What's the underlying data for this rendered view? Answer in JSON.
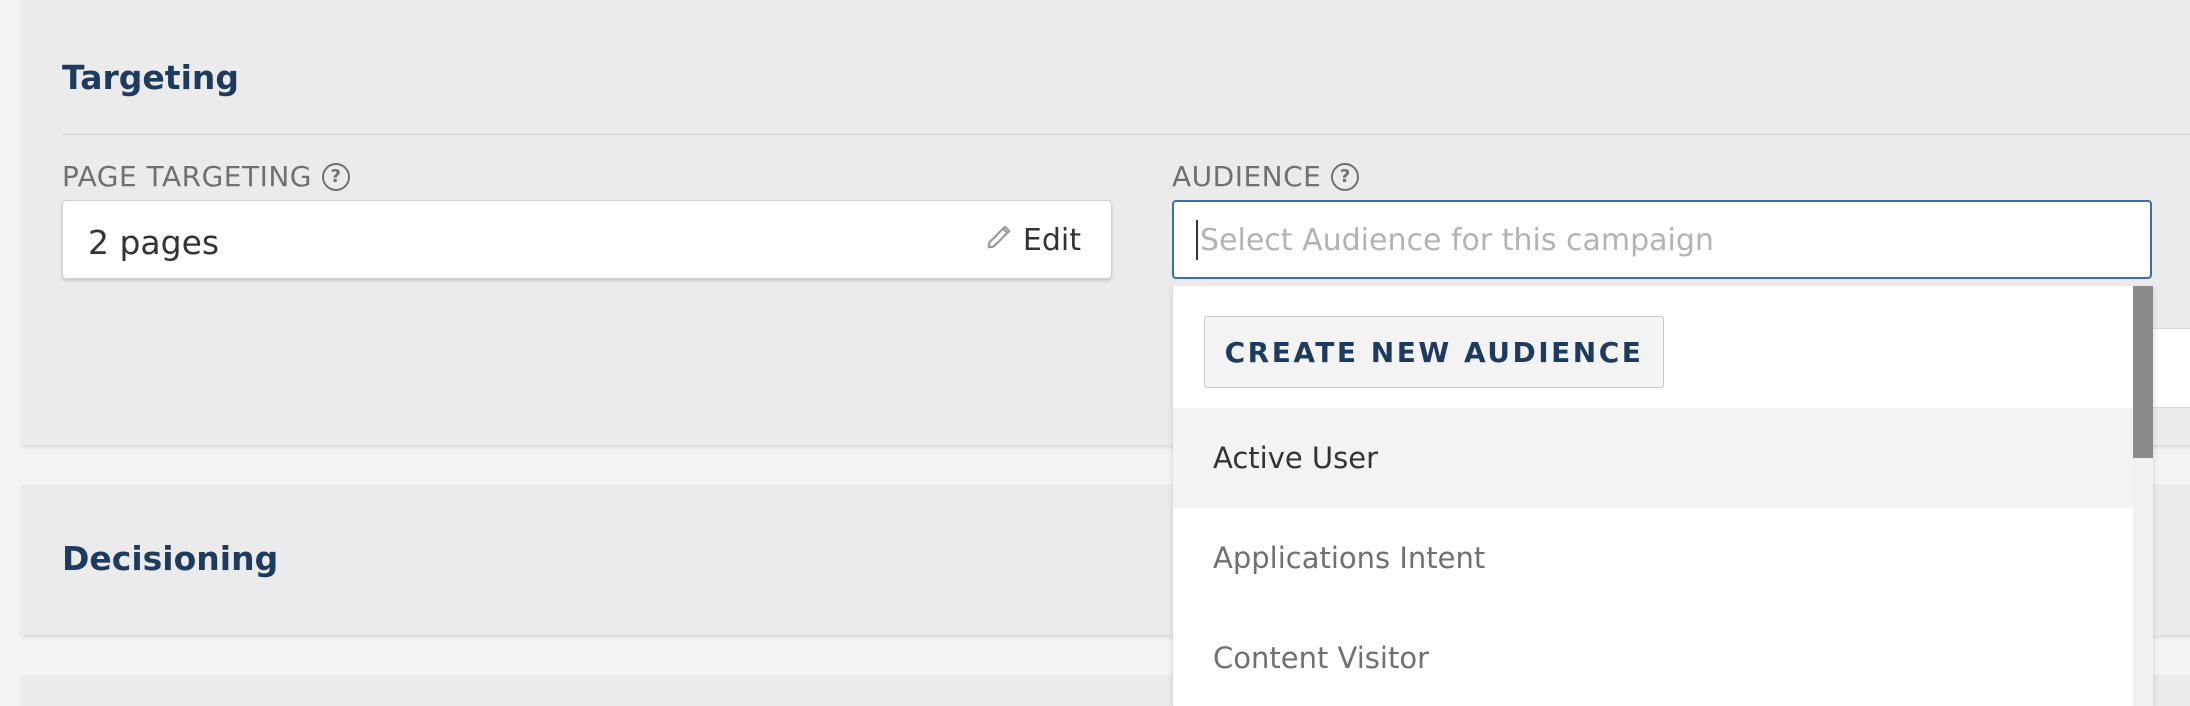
{
  "targeting": {
    "title": "Targeting",
    "page_targeting": {
      "label": "PAGE TARGETING",
      "help_glyph": "?",
      "value": "2 pages",
      "edit_label": "Edit"
    },
    "audience": {
      "label": "AUDIENCE",
      "help_glyph": "?",
      "placeholder": "Select Audience for this campaign",
      "dropdown": {
        "create_button_label": "CREATE NEW AUDIENCE",
        "options": [
          "Active User",
          "Applications Intent",
          "Content Visitor"
        ],
        "hovered_index": 0
      }
    }
  },
  "decisioning": {
    "title": "Decisioning"
  },
  "colors": {
    "accent_navy": "#1d3a5f",
    "focus_border": "#3a6fa8",
    "card_bg": "#ebebeb"
  },
  "icons": [
    "help-icon",
    "pencil-icon",
    "trash-icon"
  ]
}
